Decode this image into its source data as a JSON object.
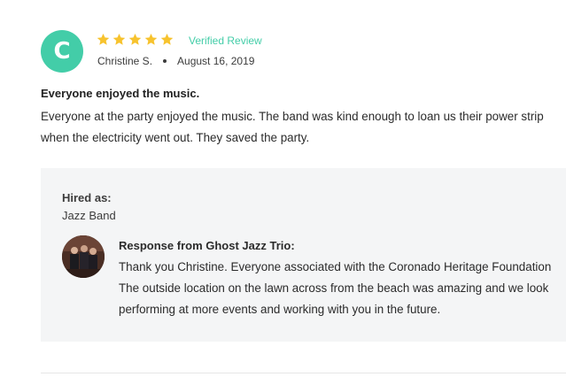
{
  "review": {
    "avatar_initial": "C",
    "rating": 5,
    "rating_max": 5,
    "verified_label": "Verified Review",
    "reviewer_name": "Christine S.",
    "date": "August 16, 2019",
    "title": "Everyone enjoyed the music.",
    "body_lines": [
      "Everyone at the party enjoyed the music. The band was kind enough to loan us their power strip",
      "when the electricity went out. They saved the party."
    ]
  },
  "response": {
    "hired_label": "Hired as:",
    "hired_value": "Jazz Band",
    "title": "Response from Ghost Jazz Trio:",
    "body_lines": [
      "Thank you Christine. Everyone associated with the Coronado Heritage Foundation",
      "The outside location on the lawn across from the beach was amazing and we look",
      "performing at more events and working with you in the future."
    ]
  },
  "colors": {
    "accent": "#43cda8",
    "star": "#f7c32e",
    "response_bg": "#f4f5f6"
  },
  "icons": {
    "star": "star-icon",
    "avatar": "avatar-initial",
    "band_photo": "band-photo"
  }
}
